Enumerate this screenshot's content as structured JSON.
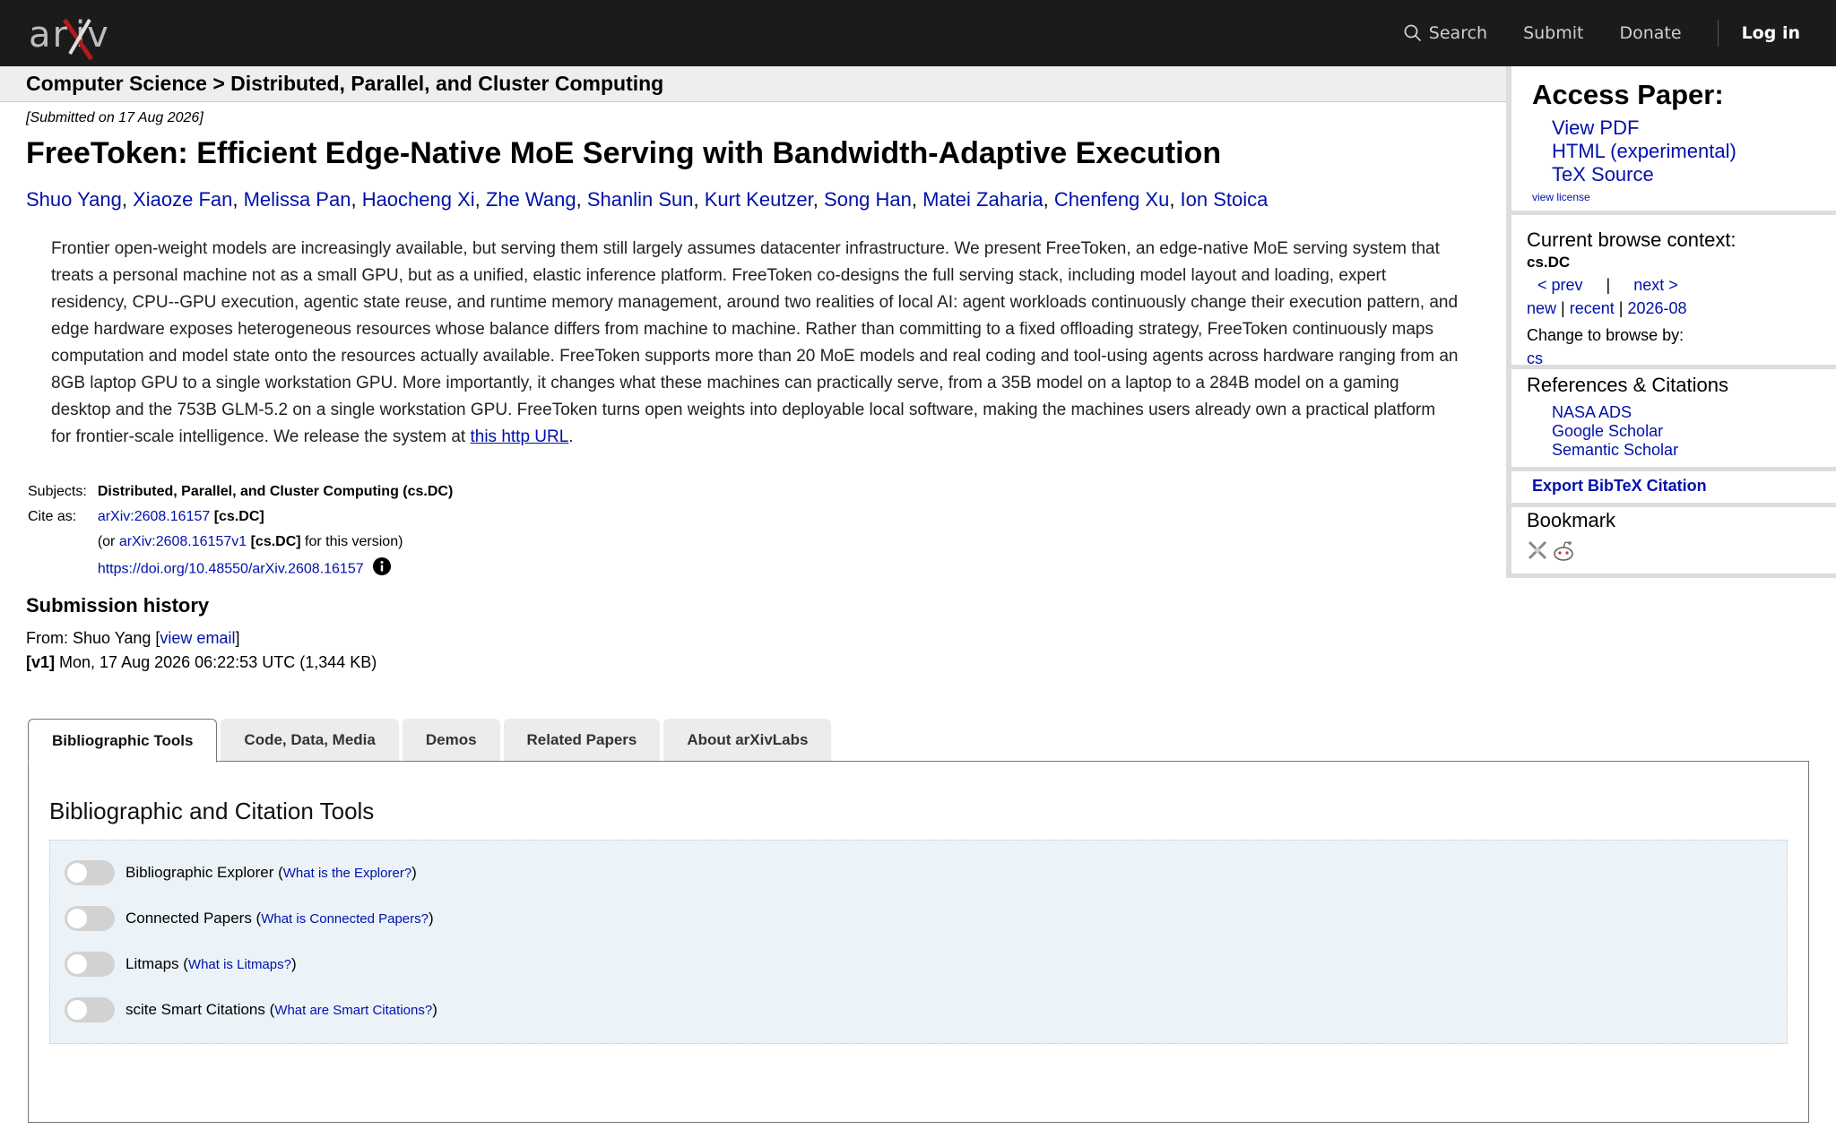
{
  "topbar": {
    "logo_text": "arXiv",
    "nav": {
      "search": "Search",
      "submit": "Submit",
      "donate": "Donate",
      "login": "Log in"
    }
  },
  "breadcrumb": "Computer Science > Distributed, Parallel, and Cluster Computing",
  "submitted": "[Submitted on 17 Aug 2026]",
  "title": "FreeToken: Efficient Edge-Native MoE Serving with Bandwidth-Adaptive Execution",
  "authors": [
    "Shuo Yang",
    "Xiaoze Fan",
    "Melissa Pan",
    "Haocheng Xi",
    "Zhe Wang",
    "Shanlin Sun",
    "Kurt Keutzer",
    "Song Han",
    "Matei Zaharia",
    "Chenfeng Xu",
    "Ion Stoica"
  ],
  "abstract": {
    "text": "Frontier open-weight models are increasingly available, but serving them still largely assumes datacenter infrastructure. We present FreeToken, an edge-native MoE serving system that treats a personal machine not as a small GPU, but as a unified, elastic inference platform. FreeToken co-designs the full serving stack, including model layout and loading, expert residency, CPU--GPU execution, agentic state reuse, and runtime memory management, around two realities of local AI: agent workloads continuously change their execution pattern, and edge hardware exposes heterogeneous resources whose balance differs from machine to machine. Rather than committing to a fixed offloading strategy, FreeToken continuously maps computation and model state onto the resources actually available. FreeToken supports more than 20 MoE models and real coding and tool-using agents across hardware ranging from an 8GB laptop GPU to a single workstation GPU. More importantly, it changes what these machines can practically serve, from a 35B model on a laptop to a 284B model on a gaming desktop and the 753B GLM-5.2 on a single workstation GPU. FreeToken turns open weights into deployable local software, making the machines users already own a practical platform for frontier-scale intelligence. We release the system at ",
    "link": "this http URL",
    "end": "."
  },
  "meta": {
    "subjects_label": "Subjects:",
    "subjects": "Distributed, Parallel, and Cluster Computing (cs.DC)",
    "cite_label": "Cite as:",
    "cite_id": "arXiv:2608.16157",
    "cite_cat": "[cs.DC]",
    "version_prefix": "(or ",
    "version_id": "arXiv:2608.16157v1",
    "version_cat": "[cs.DC]",
    "version_suffix": " for this version)",
    "doi": "https://doi.org/10.48550/arXiv.2608.16157"
  },
  "history": {
    "heading": "Submission history",
    "from_prefix": "From: Shuo Yang [",
    "view_email": "view email",
    "from_suffix": "]",
    "v1_label": "[v1]",
    "v1_text": " Mon, 17 Aug 2026 06:22:53 UTC (1,344 KB)"
  },
  "tabs": [
    "Bibliographic Tools",
    "Code, Data, Media",
    "Demos",
    "Related Papers",
    "About arXivLabs"
  ],
  "panel": {
    "heading": "Bibliographic and Citation Tools",
    "tools": [
      {
        "name": "Bibliographic Explorer",
        "help": "What is the Explorer?",
        "enabled": false
      },
      {
        "name": "Connected Papers",
        "help": "What is Connected Papers?",
        "enabled": false
      },
      {
        "name": "Litmaps",
        "help": "What is Litmaps?",
        "enabled": false
      },
      {
        "name": "scite Smart Citations",
        "help": "What are Smart Citations?",
        "enabled": false
      }
    ]
  },
  "sidebar": {
    "access_heading": "Access Paper:",
    "view_pdf": "View PDF",
    "html": "HTML (experimental)",
    "tex": "TeX Source",
    "license": "view license",
    "browse_heading": "Current browse context:",
    "context": "cs.DC",
    "prev": "< prev",
    "sep": "|",
    "next": "next >",
    "new": "new",
    "recent": "recent",
    "month": "2026-08",
    "change": "Change to browse by:",
    "cs": "cs",
    "refs_heading": "References & Citations",
    "refs": [
      "NASA ADS",
      "Google Scholar",
      "Semantic Scholar"
    ],
    "bibtex": "Export BibTeX Citation",
    "bookmark_heading": "Bookmark",
    "bookmark_icons": [
      "bibsonomy-icon",
      "reddit-icon"
    ]
  },
  "colors": {
    "topbar": "#1b1b1b",
    "link": "#0011aa",
    "logo_red": "#b31b1b",
    "tools_bg": "#ebf3f8"
  }
}
